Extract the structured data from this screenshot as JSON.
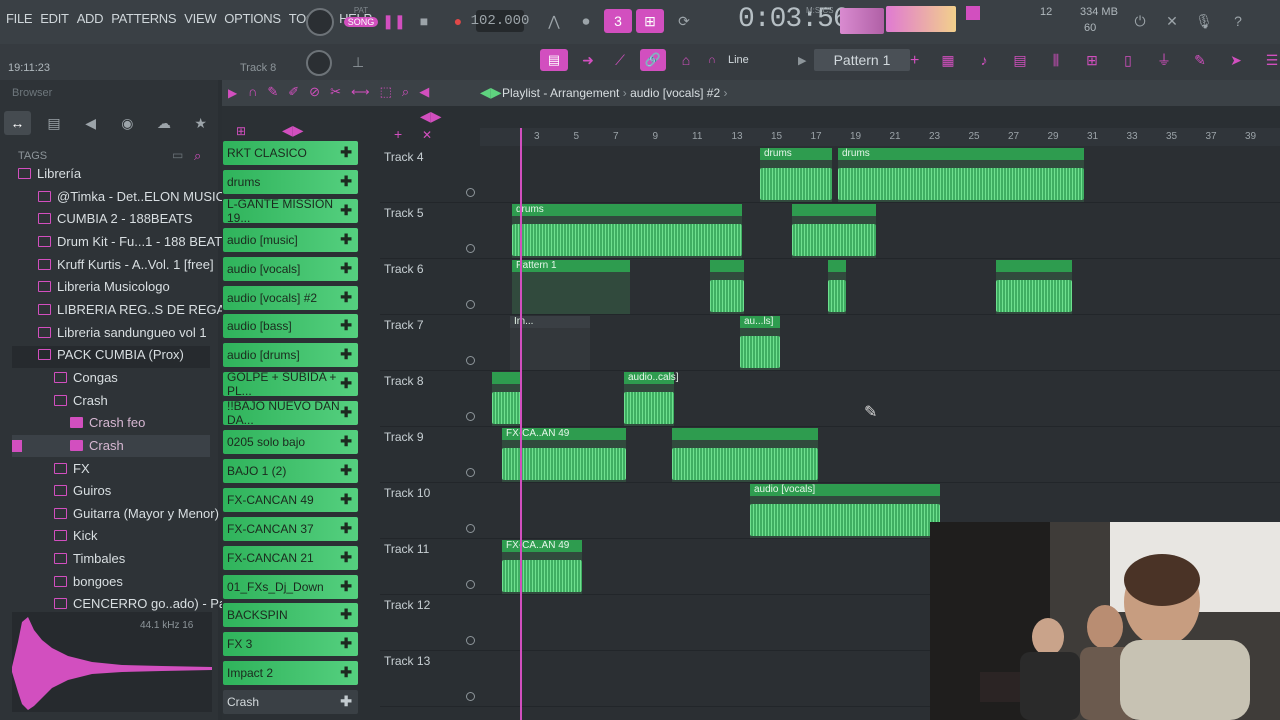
{
  "menu": [
    "FILE",
    "EDIT",
    "ADD",
    "PATTERNS",
    "VIEW",
    "OPTIONS",
    "TOOLS",
    "HELP"
  ],
  "transport": {
    "mode_top": "PAT",
    "mode_song": "SONG",
    "tempo": "102.000",
    "time": "0:03:56",
    "time_unit": "M:S:CS"
  },
  "status": {
    "cpu_value": "12",
    "memory": "334 MB",
    "polyphony": "60"
  },
  "hint_bar": {
    "time": "19:11:23",
    "track": "Track 8"
  },
  "toolbar2": {
    "snap": "Line",
    "pattern": "Pattern 1"
  },
  "browser": {
    "title": "Browser",
    "tags_label": "TAGS",
    "tree": [
      {
        "label": "Librería",
        "indent": 0
      },
      {
        "label": "@Timka - Det..ELON MUSIC_",
        "indent": 1
      },
      {
        "label": "CUMBIA 2 - 188BEATS",
        "indent": 1
      },
      {
        "label": "Drum Kit - Fu...1 - 188 BEATS",
        "indent": 1
      },
      {
        "label": "Kruff Kurtis - A..Vol. 1 [free]",
        "indent": 1
      },
      {
        "label": "Libreria Musicologo",
        "indent": 1
      },
      {
        "label": "LIBRERIA REG..S DE REGALO",
        "indent": 1
      },
      {
        "label": "Libreria sandungueo vol 1",
        "indent": 1
      },
      {
        "label": "PACK CUMBIA (Prox)",
        "indent": 1
      },
      {
        "label": "Congas",
        "indent": 2
      },
      {
        "label": "Crash",
        "indent": 2
      },
      {
        "label": "Crash feo",
        "indent": 3
      },
      {
        "label": "Crash",
        "indent": 3
      },
      {
        "label": "FX",
        "indent": 2
      },
      {
        "label": "Guiros",
        "indent": 2
      },
      {
        "label": "Guitarra (Mayor y Menor)",
        "indent": 2
      },
      {
        "label": "Kick",
        "indent": 2
      },
      {
        "label": "Timbales",
        "indent": 2
      },
      {
        "label": "bongoes",
        "indent": 2
      },
      {
        "label": "CENCERRO go..ado) - Part_1",
        "indent": 2
      }
    ],
    "sample_info": "44.1 kHz 16"
  },
  "channels": [
    {
      "label": "RKT CLASICO",
      "style": "green"
    },
    {
      "label": "drums",
      "style": "green"
    },
    {
      "label": "L-GANTE MISSION 19...",
      "style": "green"
    },
    {
      "label": "audio [music]",
      "style": "green"
    },
    {
      "label": "audio [vocals]",
      "style": "green"
    },
    {
      "label": "audio [vocals] #2",
      "style": "green"
    },
    {
      "label": "audio [bass]",
      "style": "green"
    },
    {
      "label": "audio [drums]",
      "style": "green"
    },
    {
      "label": "GOLPE + SUBIDA + PL...",
      "style": "green"
    },
    {
      "label": "!!BAJO NUEVO DAN DA...",
      "style": "green"
    },
    {
      "label": "0205 solo bajo",
      "style": "green"
    },
    {
      "label": "BAJO 1 (2)",
      "style": "green"
    },
    {
      "label": "FX-CANCAN 49",
      "style": "green"
    },
    {
      "label": "FX-CANCAN 37",
      "style": "green"
    },
    {
      "label": "FX-CANCAN 21",
      "style": "green"
    },
    {
      "label": "01_FXs_Dj_Down",
      "style": "green"
    },
    {
      "label": "BACKSPIN",
      "style": "green"
    },
    {
      "label": "FX 3",
      "style": "green"
    },
    {
      "label": "Impact 2",
      "style": "green"
    },
    {
      "label": "Crash",
      "style": "dark"
    }
  ],
  "playlist": {
    "title": "Playlist - Arrangement",
    "breadcrumb": "audio [vocals] #2",
    "ruler": [
      "3",
      "5",
      "7",
      "9",
      "11",
      "13",
      "15",
      "17",
      "19",
      "21",
      "23",
      "25",
      "27",
      "29",
      "31",
      "33",
      "35",
      "37",
      "39"
    ],
    "tracks": [
      "Track 4",
      "Track 5",
      "Track 6",
      "Track 7",
      "Track 8",
      "Track 9",
      "Track 10",
      "Track 11",
      "Track 12",
      "Track 13"
    ],
    "clips": [
      {
        "title": "drums"
      },
      {
        "title": "drums"
      },
      {
        "title": "drums"
      },
      {
        "title": "Pattern 1"
      },
      {
        "title": "Im..."
      },
      {
        "title": "au...ls]"
      },
      {
        "title": "audio..cals]"
      },
      {
        "title": "FX-CA..AN 49"
      },
      {
        "title": "audio [vocals]"
      },
      {
        "title": "FX-CA..AN 49"
      }
    ]
  },
  "colors": {
    "accent": "#d24fbf",
    "clip_green": "#2e9c4f",
    "wave_green": "#6fe08f"
  }
}
